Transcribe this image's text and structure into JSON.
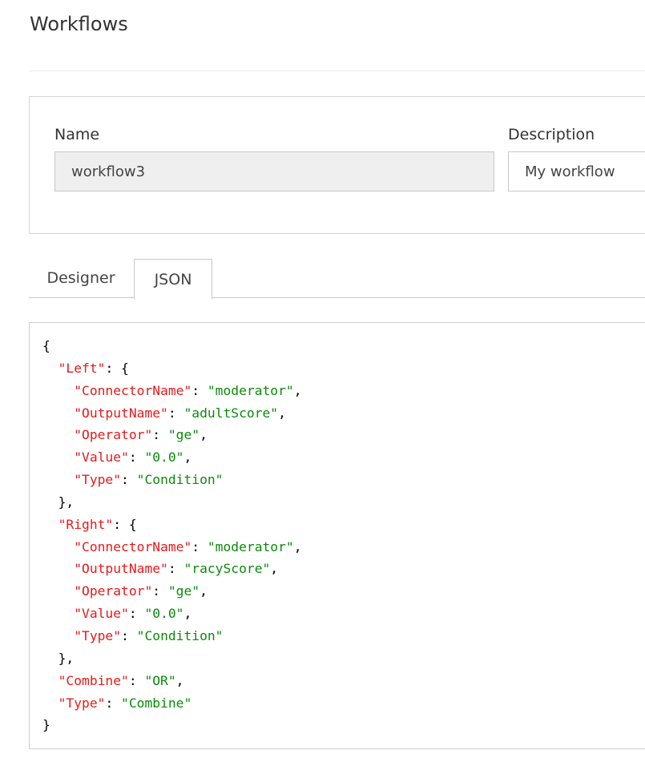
{
  "header": {
    "title": "Workflows"
  },
  "form": {
    "name_label": "Name",
    "name_value": "workflow3",
    "description_label": "Description",
    "description_value": "My workflow"
  },
  "tabs": [
    {
      "label": "Designer",
      "active": false
    },
    {
      "label": "JSON",
      "active": true
    }
  ],
  "json_editor": {
    "lines": [
      [
        {
          "t": "p",
          "v": "{"
        }
      ],
      [
        {
          "t": "p",
          "v": "  "
        },
        {
          "t": "k",
          "v": "\"Left\""
        },
        {
          "t": "p",
          "v": ": {"
        }
      ],
      [
        {
          "t": "p",
          "v": "    "
        },
        {
          "t": "k",
          "v": "\"ConnectorName\""
        },
        {
          "t": "p",
          "v": ": "
        },
        {
          "t": "s",
          "v": "\"moderator\""
        },
        {
          "t": "p",
          "v": ","
        }
      ],
      [
        {
          "t": "p",
          "v": "    "
        },
        {
          "t": "k",
          "v": "\"OutputName\""
        },
        {
          "t": "p",
          "v": ": "
        },
        {
          "t": "s",
          "v": "\"adultScore\""
        },
        {
          "t": "p",
          "v": ","
        }
      ],
      [
        {
          "t": "p",
          "v": "    "
        },
        {
          "t": "k",
          "v": "\"Operator\""
        },
        {
          "t": "p",
          "v": ": "
        },
        {
          "t": "s",
          "v": "\"ge\""
        },
        {
          "t": "p",
          "v": ","
        }
      ],
      [
        {
          "t": "p",
          "v": "    "
        },
        {
          "t": "k",
          "v": "\"Value\""
        },
        {
          "t": "p",
          "v": ": "
        },
        {
          "t": "s",
          "v": "\"0.0\""
        },
        {
          "t": "p",
          "v": ","
        }
      ],
      [
        {
          "t": "p",
          "v": "    "
        },
        {
          "t": "k",
          "v": "\"Type\""
        },
        {
          "t": "p",
          "v": ": "
        },
        {
          "t": "s",
          "v": "\"Condition\""
        }
      ],
      [
        {
          "t": "p",
          "v": "  },"
        }
      ],
      [
        {
          "t": "p",
          "v": "  "
        },
        {
          "t": "k",
          "v": "\"Right\""
        },
        {
          "t": "p",
          "v": ": {"
        }
      ],
      [
        {
          "t": "p",
          "v": "    "
        },
        {
          "t": "k",
          "v": "\"ConnectorName\""
        },
        {
          "t": "p",
          "v": ": "
        },
        {
          "t": "s",
          "v": "\"moderator\""
        },
        {
          "t": "p",
          "v": ","
        }
      ],
      [
        {
          "t": "p",
          "v": "    "
        },
        {
          "t": "k",
          "v": "\"OutputName\""
        },
        {
          "t": "p",
          "v": ": "
        },
        {
          "t": "s",
          "v": "\"racyScore\""
        },
        {
          "t": "p",
          "v": ","
        }
      ],
      [
        {
          "t": "p",
          "v": "    "
        },
        {
          "t": "k",
          "v": "\"Operator\""
        },
        {
          "t": "p",
          "v": ": "
        },
        {
          "t": "s",
          "v": "\"ge\""
        },
        {
          "t": "p",
          "v": ","
        }
      ],
      [
        {
          "t": "p",
          "v": "    "
        },
        {
          "t": "k",
          "v": "\"Value\""
        },
        {
          "t": "p",
          "v": ": "
        },
        {
          "t": "s",
          "v": "\"0.0\""
        },
        {
          "t": "p",
          "v": ","
        }
      ],
      [
        {
          "t": "p",
          "v": "    "
        },
        {
          "t": "k",
          "v": "\"Type\""
        },
        {
          "t": "p",
          "v": ": "
        },
        {
          "t": "s",
          "v": "\"Condition\""
        }
      ],
      [
        {
          "t": "p",
          "v": "  },"
        }
      ],
      [
        {
          "t": "p",
          "v": "  "
        },
        {
          "t": "k",
          "v": "\"Combine\""
        },
        {
          "t": "p",
          "v": ": "
        },
        {
          "t": "s",
          "v": "\"OR\""
        },
        {
          "t": "p",
          "v": ","
        }
      ],
      [
        {
          "t": "p",
          "v": "  "
        },
        {
          "t": "k",
          "v": "\"Type\""
        },
        {
          "t": "p",
          "v": ": "
        },
        {
          "t": "s",
          "v": "\"Combine\""
        }
      ],
      [
        {
          "t": "p",
          "v": "}"
        }
      ]
    ]
  },
  "colors": {
    "json_key": "#e8191b",
    "json_string": "#0b8a0b",
    "border": "#c8c8c8",
    "disabled_input_bg": "#efefef"
  }
}
